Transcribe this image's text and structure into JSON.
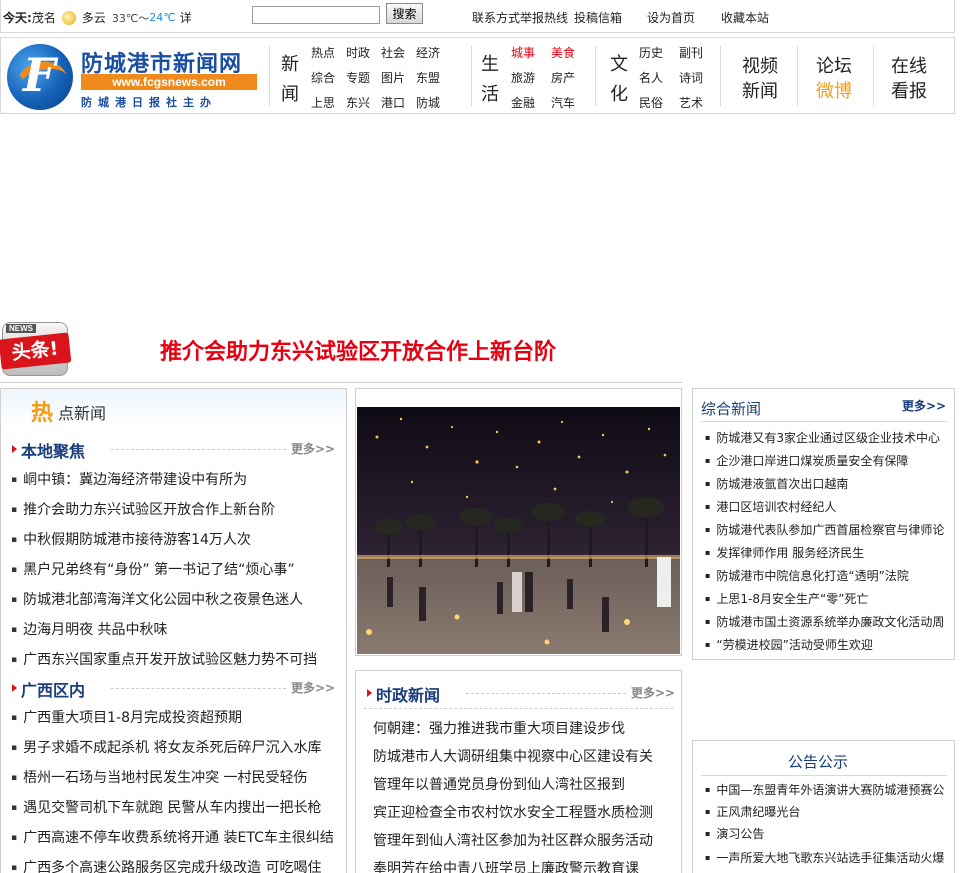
{
  "topbar": {
    "today_label": "今天:",
    "city": "茂名",
    "weather": "多云",
    "temp_low": "33℃～",
    "temp_high": "24℃",
    "detail": "详",
    "search_placeholder": "",
    "search_button": "搜索",
    "contact": "联系方式",
    "report": "举报热线",
    "submit": "投稿信箱",
    "set_home": "设为首页",
    "favorite": "收藏本站"
  },
  "header": {
    "logo_name": "防城港市新闻网",
    "logo_url": "www.fcgsnews.com",
    "logo_sub": "防城港日报社主办",
    "news_group": {
      "big": [
        "新",
        "闻"
      ],
      "items": [
        "热点",
        "时政",
        "社会",
        "经济",
        "综合",
        "专题",
        "图片",
        "东盟",
        "上思",
        "东兴",
        "港口",
        "防城"
      ]
    },
    "life_group": {
      "big": [
        "生",
        "活"
      ],
      "items": [
        "城事",
        "美食",
        "旅游",
        "房产",
        "金融",
        "汽车"
      ]
    },
    "culture_group": {
      "big": [
        "文",
        "化"
      ],
      "items": [
        "历史",
        "副刊",
        "名人",
        "诗词",
        "民俗",
        "艺术"
      ]
    },
    "video": [
      "视频",
      "新闻"
    ],
    "forum": [
      "论坛",
      "微博"
    ],
    "online": [
      "在线",
      "看报"
    ]
  },
  "headline": {
    "badge_top": "NEWS",
    "badge": "头条!",
    "text": "推介会助力东兴试验区开放合作上新台阶"
  },
  "hot_news": {
    "title": "点新闻",
    "icon_char": "热",
    "local": {
      "name": "本地聚焦",
      "more": "更多>>",
      "items": [
        "峒中镇：冀边海经济带建设中有所为",
        "推介会助力东兴试验区开放合作上新台阶",
        "中秋假期防城港市接待游客14万人次",
        "黑户兄弟终有“身份” 第一书记了结“烦心事”",
        "防城港北部湾海洋文化公园中秋之夜景色迷人",
        "边海月明夜 共品中秋味",
        "广西东兴国家重点开发开放试验区魅力势不可挡"
      ]
    },
    "guangxi": {
      "name": "广西区内",
      "more": "更多>>",
      "items": [
        "广西重大项目1-8月完成投资超预期",
        "男子求婚不成起杀机 将女友杀死后碎尸沉入水库",
        "梧州一石场与当地村民发生冲突 一村民受轻伤",
        "遇见交警司机下车就跑 民警从车内搜出一把长枪",
        "广西高速不停车收费系统将开通 装ETC车主很纠结",
        "广西多个高速公路服务区完成升级改造 可吃喝住"
      ]
    }
  },
  "politics": {
    "name": "时政新闻",
    "more": "更多>>",
    "items": [
      "何朝建：强力推进我市重大项目建设步伐",
      "防城港市人大调研组集中视察中心区建设有关",
      "管理年以普通党员身份到仙人湾社区报到",
      "宾正迎检查全市农村饮水安全工程暨水质检测",
      "管理年到仙人湾社区参加为社区群众服务活动",
      "奉明芳在给中青八班学员上廉政警示教育课"
    ]
  },
  "general": {
    "name": "综合新闻",
    "more": "更多>>",
    "items": [
      "防城港又有3家企业通过区级企业技术中心",
      "企沙港口岸进口煤炭质量安全有保障",
      "防城港液氩首次出口越南",
      "港口区培训农村经纪人",
      "防城港代表队参加广西首届检察官与律师论",
      "发挥律师作用 服务经济民生",
      "防城港市中院信息化打造“透明”法院",
      "上思1-8月安全生产“零”死亡",
      "防城港市国土资源系统举办廉政文化活动周",
      "“劳模进校园”活动受师生欢迎"
    ]
  },
  "notices": {
    "name": "公告公示",
    "items": [
      "中国—东盟青年外语演讲大赛防城港预赛公",
      "正风肃纪曝光台",
      "演习公告",
      "一声所爱大地飞歌东兴站选手征集活动火爆"
    ]
  }
}
